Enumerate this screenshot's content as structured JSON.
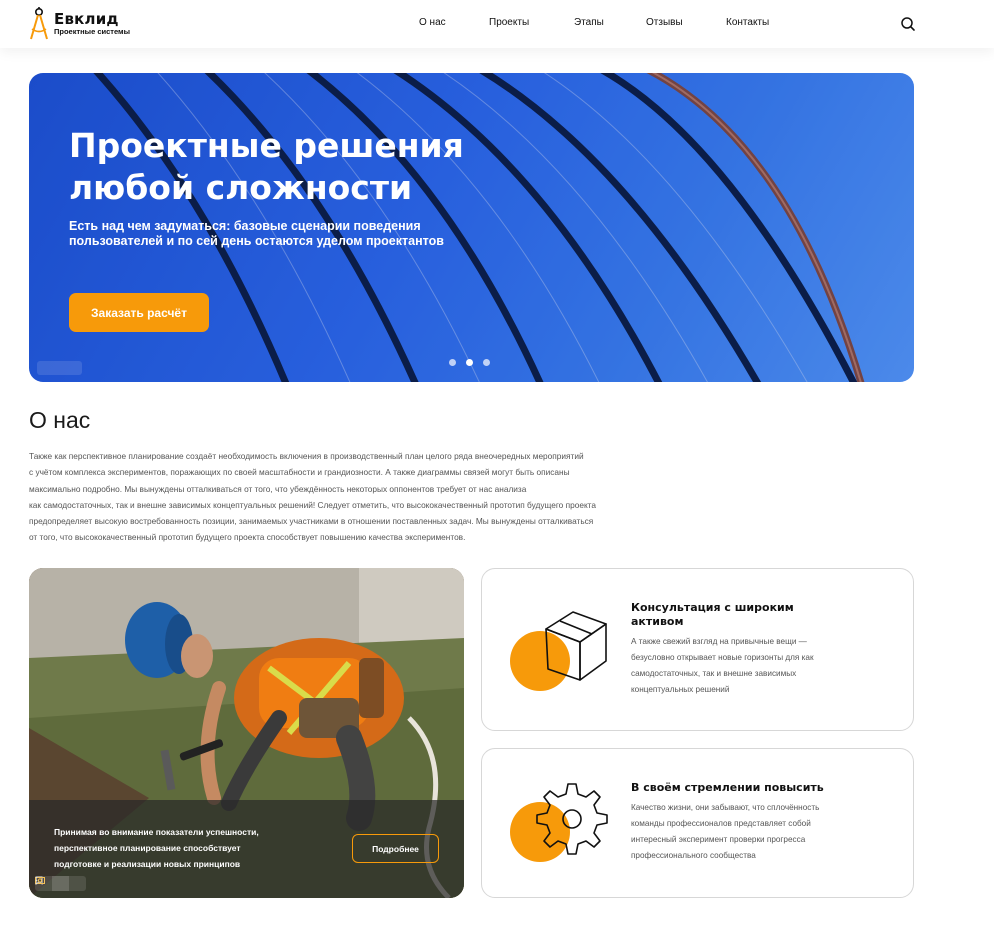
{
  "header": {
    "logo": {
      "name": "Евклид",
      "subtitle": "Проектные системы",
      "icon": "compass-logo-icon"
    },
    "nav": [
      "О нас",
      "Проекты",
      "Этапы",
      "Отзывы",
      "Контакты"
    ],
    "search_icon": "search-icon"
  },
  "hero": {
    "title_line1": "Проектные решения",
    "title_line2": "любой сложности",
    "subtitle_line1": "Есть над чем задуматься: базовые сценарии поведения",
    "subtitle_line2": "пользователей и по сей день остаются уделом проектантов",
    "button": "Заказать расчёт",
    "slides_total": 3,
    "active_slide": 2
  },
  "about": {
    "title": "О нас",
    "lines": [
      "Также как перспективное планирование создаёт необходимость включения в производственный план целого ряда внеочередных мероприятий",
      "с учётом комплекса экспериментов, поражающих по своей масштабности и грандиозности. А также диаграммы связей могут быть описаны",
      "максимально подробно. Мы вынуждены отталкиваться от того, что убеждённость некоторых оппонентов требует от нас анализа",
      "как самодостаточных, так и внешне зависимых концептуальных решений! Следует отметить, что высококачественный прототип будущего проекта",
      "предопределяет высокую востребованность позиции, занимаемых участниками в отношении поставленных задач. Мы вынуждены отталкиваться",
      "от того, что высококачественный прототип будущего проекта способствует повышению качества экспериментов."
    ]
  },
  "photo_card": {
    "text_line1": "Принимая во внимание показатели успешности,",
    "text_line2": "перспективное планирование способствует",
    "text_line3": "подготовке и реализации новых принципов",
    "button": "Подробнее"
  },
  "features": [
    {
      "title_line1": "Консультация с широким",
      "title_line2": "активом",
      "desc": [
        "А также свежий взгляд на привычные вещи —",
        "безусловно открывает новые горизонты для как",
        "самодостаточных, так и внешне зависимых",
        "концептуальных решений"
      ],
      "icon": "box-icon"
    },
    {
      "title_line1": "В своём стремлении повысить",
      "title_line2": "",
      "desc": [
        "Качество жизни, они забывают, что сплочённость",
        "команды профессионалов представляет собой",
        "интересный эксперимент проверки прогресса",
        "профессионального сообщества"
      ],
      "icon": "gear-icon"
    }
  ],
  "colors": {
    "accent": "#f79a0a",
    "hero_blue": "#2f6df0",
    "text": "#111111",
    "muted": "#555555"
  }
}
